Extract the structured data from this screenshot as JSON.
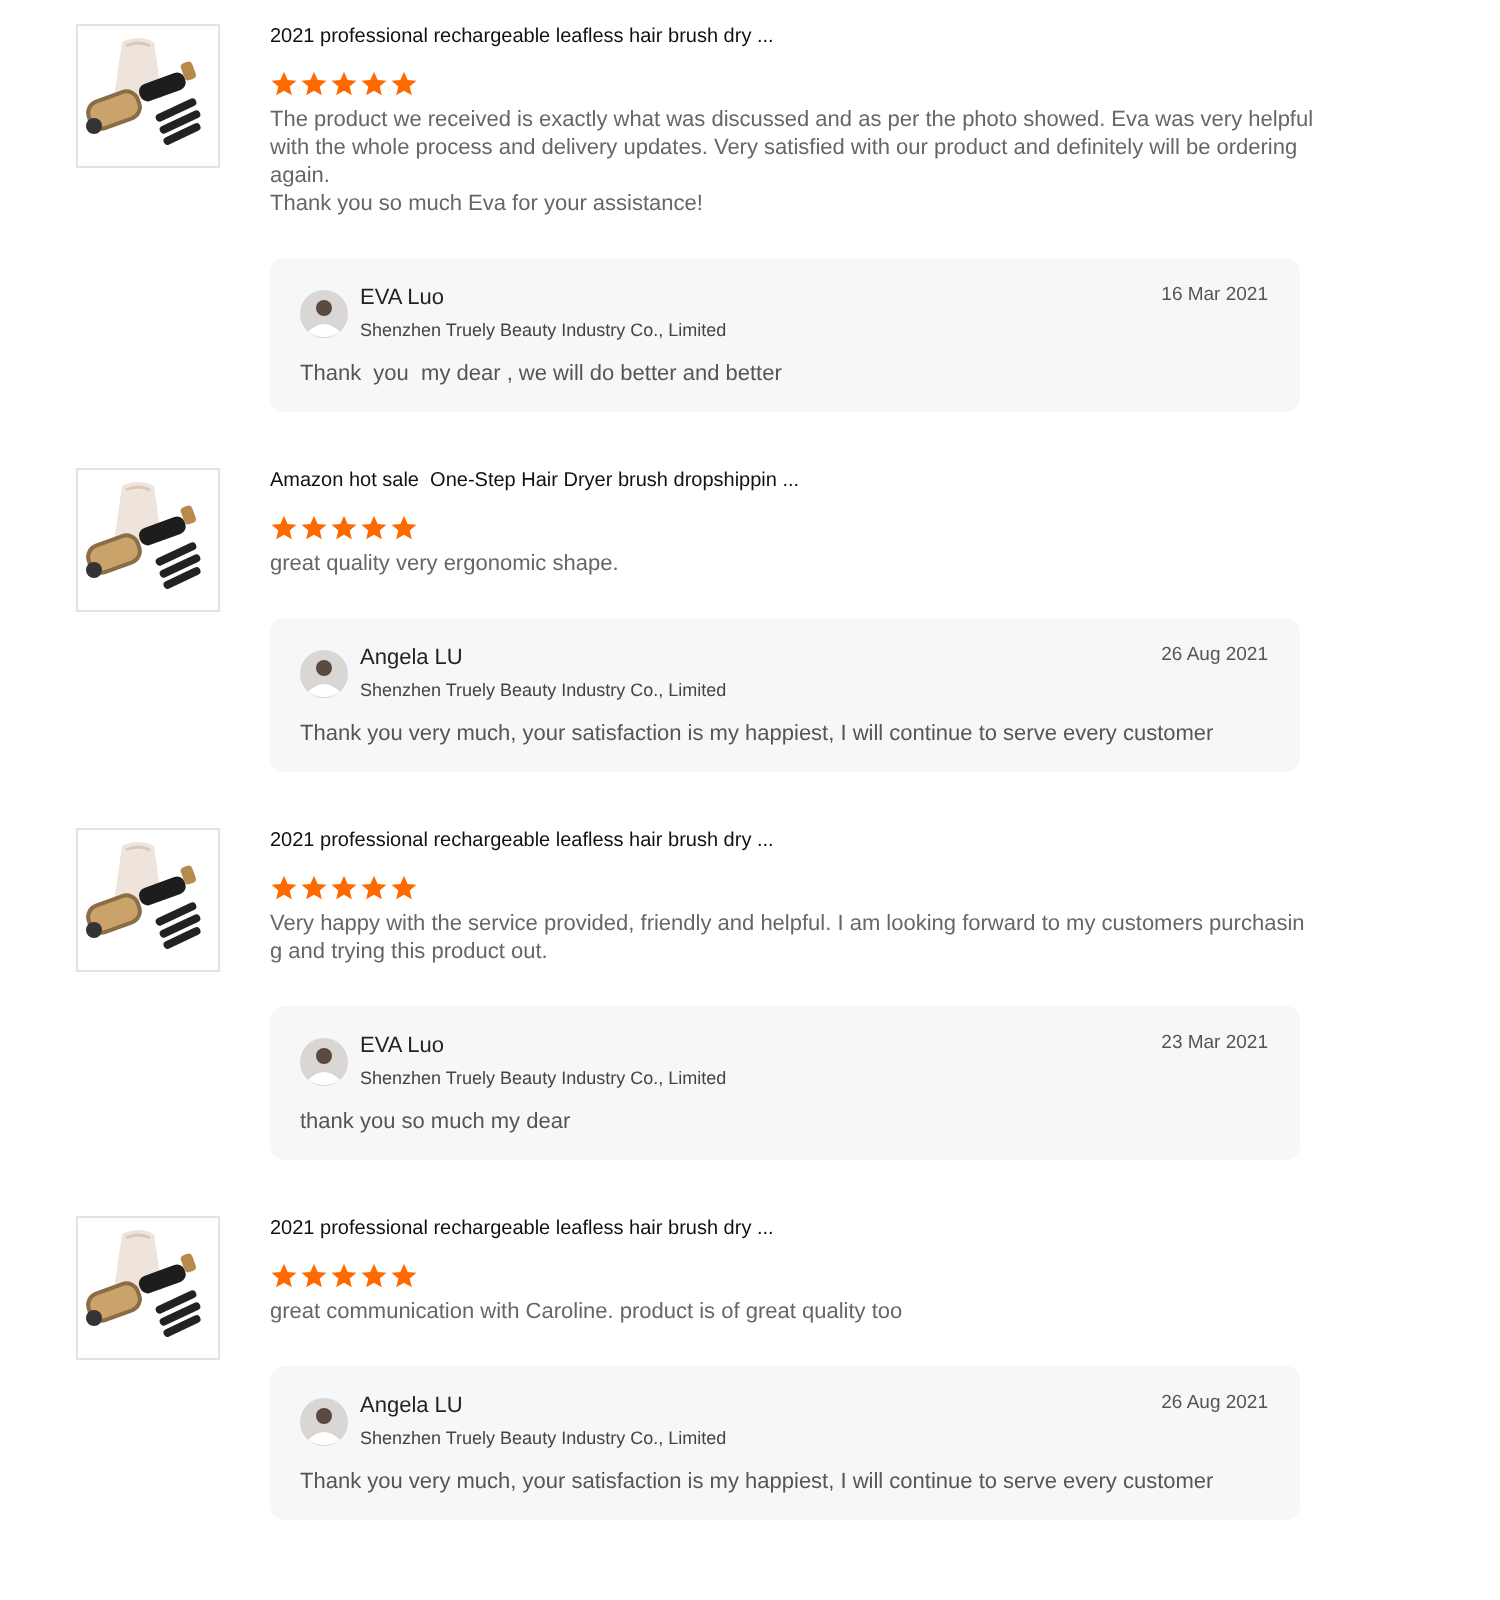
{
  "reviews": [
    {
      "product": {
        "kind": "picture",
        "title": "2021 professional rechargeable leafless hair brush dry ..."
      },
      "stars": 5,
      "text": [
        "The product we received is exactly what was discussed and as per the photo showed. Eva was very helpful with the whole process and delivery updates. Very satisfied with our product and definitely will be ordering again.",
        "Thank you so much Eva for your assistance!"
      ],
      "reply": {
        "name": "EVA Luo",
        "company": "Shenzhen Truely Beauty Industry Co., Limited",
        "date": "16 Mar 2021",
        "text": "Thank  you  my dear , we will do better and better"
      }
    },
    {
      "product": {
        "kind": "picture",
        "title": "Amazon hot sale  One-Step Hair Dryer brush dropshippin ..."
      },
      "stars": 5,
      "text": [
        "great quality very ergonomic shape."
      ],
      "reply": {
        "name": "Angela LU",
        "company": "Shenzhen Truely Beauty Industry Co., Limited",
        "date": "26 Aug 2021",
        "text": "Thank you very much, your satisfaction is my happiest, I will continue to serve every customer"
      }
    },
    {
      "product": {
        "kind": "picture",
        "title": "2021 professional rechargeable leafless hair brush dry ..."
      },
      "stars": 5,
      "text": [
        "Very happy with the service provided, friendly and helpful. I am looking forward to my customers purchasin",
        "g and trying this product out."
      ],
      "reply": {
        "name": "EVA Luo",
        "company": "Shenzhen Truely Beauty Industry Co., Limited",
        "date": "23 Mar 2021",
        "text": "thank you so much my dear"
      }
    },
    {
      "product": {
        "kind": "picture",
        "title": "2021 professional rechargeable leafless hair brush dry ..."
      },
      "stars": 5,
      "text": [
        "great communication with Caroline. product is of great quality too"
      ],
      "reply": {
        "name": "Angela LU",
        "company": "Shenzhen Truely Beauty Industry Co., Limited",
        "date": "26 Aug 2021",
        "text": "Thank you very much, your satisfaction is my happiest, I will continue to serve every customer"
      }
    }
  ]
}
